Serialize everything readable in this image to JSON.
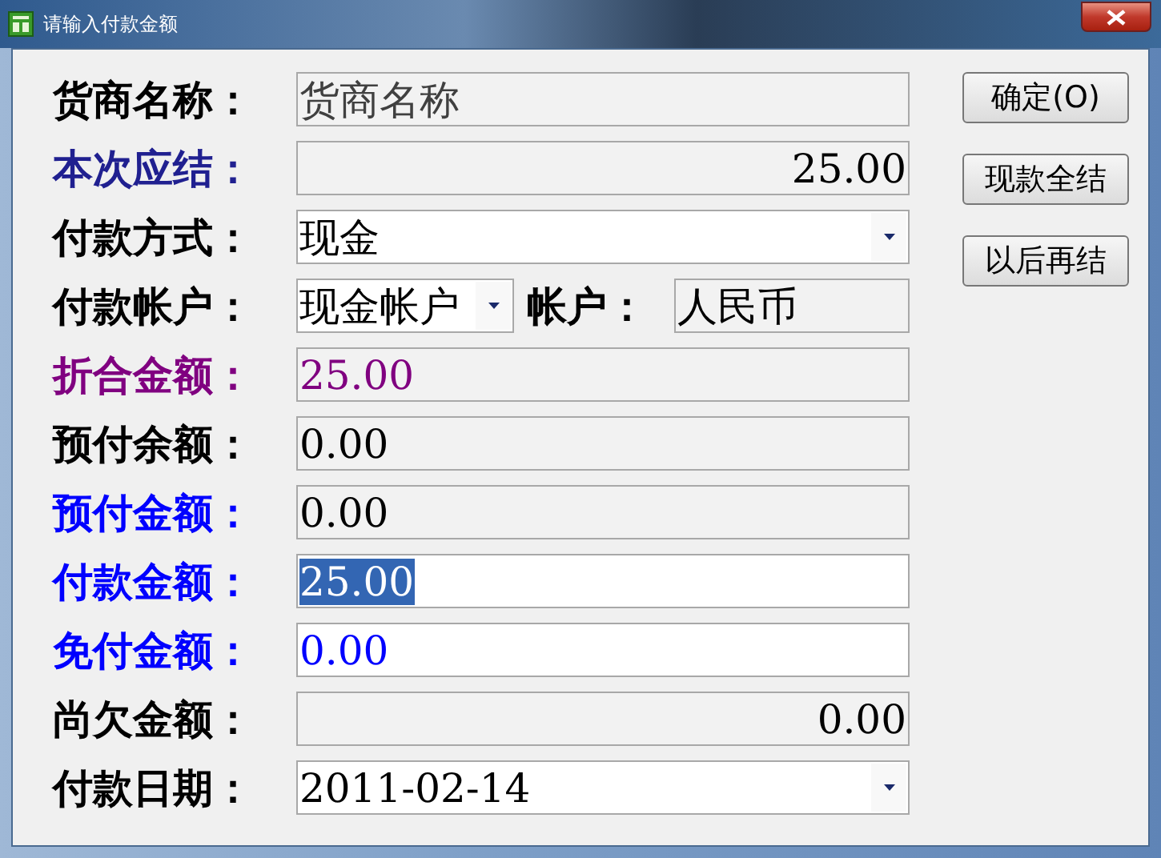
{
  "window": {
    "title": "请输入付款金额"
  },
  "rows": [
    {
      "label": "货商名称：",
      "color": "#000000",
      "kind": "single",
      "fields": [
        {
          "kind": "readonly",
          "value": "货商名称",
          "right_aligned": false,
          "color": "#404040"
        }
      ]
    },
    {
      "label": "本次应结：",
      "color": "#202090",
      "kind": "single",
      "fields": [
        {
          "kind": "readonly",
          "value": "25.00",
          "right_aligned": true,
          "color": "#000000"
        }
      ]
    },
    {
      "label": "付款方式：",
      "color": "#000000",
      "kind": "single",
      "fields": [
        {
          "kind": "dropdown",
          "value": "现金",
          "right_aligned": false,
          "color": "#000000"
        }
      ]
    },
    {
      "label": "付款帐户：",
      "color": "#000000",
      "kind": "split",
      "fields": [
        {
          "kind": "dropdown",
          "value": "现金帐户",
          "right_aligned": false,
          "color": "#000000"
        },
        {
          "kind": "caption",
          "value": "帐户：",
          "color": "#000000"
        },
        {
          "kind": "readonly",
          "value": "人民币",
          "right_aligned": false,
          "color": "#000000"
        }
      ]
    },
    {
      "label": "折合金额：",
      "color": "#800080",
      "kind": "single",
      "fields": [
        {
          "kind": "readonly",
          "value": "25.00",
          "right_aligned": false,
          "color": "#800080"
        }
      ]
    },
    {
      "label": "预付余额：",
      "color": "#000000",
      "kind": "single",
      "fields": [
        {
          "kind": "readonly",
          "value": "0.00",
          "right_aligned": false,
          "color": "#000000"
        }
      ]
    },
    {
      "label": "预付金额：",
      "color": "#0000ff",
      "kind": "single",
      "fields": [
        {
          "kind": "readonly",
          "value": "0.00",
          "right_aligned": false,
          "color": "#000000"
        }
      ]
    },
    {
      "label": "付款金额：",
      "color": "#0000ff",
      "kind": "single",
      "fields": [
        {
          "kind": "input",
          "value": "25.00",
          "right_aligned": false,
          "highlighted": true
        }
      ]
    },
    {
      "label": "免付金额：",
      "color": "#0000ff",
      "kind": "single",
      "fields": [
        {
          "kind": "input",
          "value": "0.00",
          "right_aligned": false,
          "color": "#0000ff"
        }
      ]
    },
    {
      "label": "尚欠金额：",
      "color": "#000000",
      "kind": "single",
      "fields": [
        {
          "kind": "readonly",
          "value": "0.00",
          "right_aligned": true,
          "color": "#000000"
        }
      ]
    },
    {
      "label": "付款日期：",
      "color": "#000000",
      "kind": "single",
      "fields": [
        {
          "kind": "dropdown",
          "value": "2011-02-14",
          "right_aligned": false,
          "color": "#000000"
        }
      ]
    }
  ],
  "buttons": [
    "确定(O)",
    "现款全结",
    "以后再结"
  ]
}
